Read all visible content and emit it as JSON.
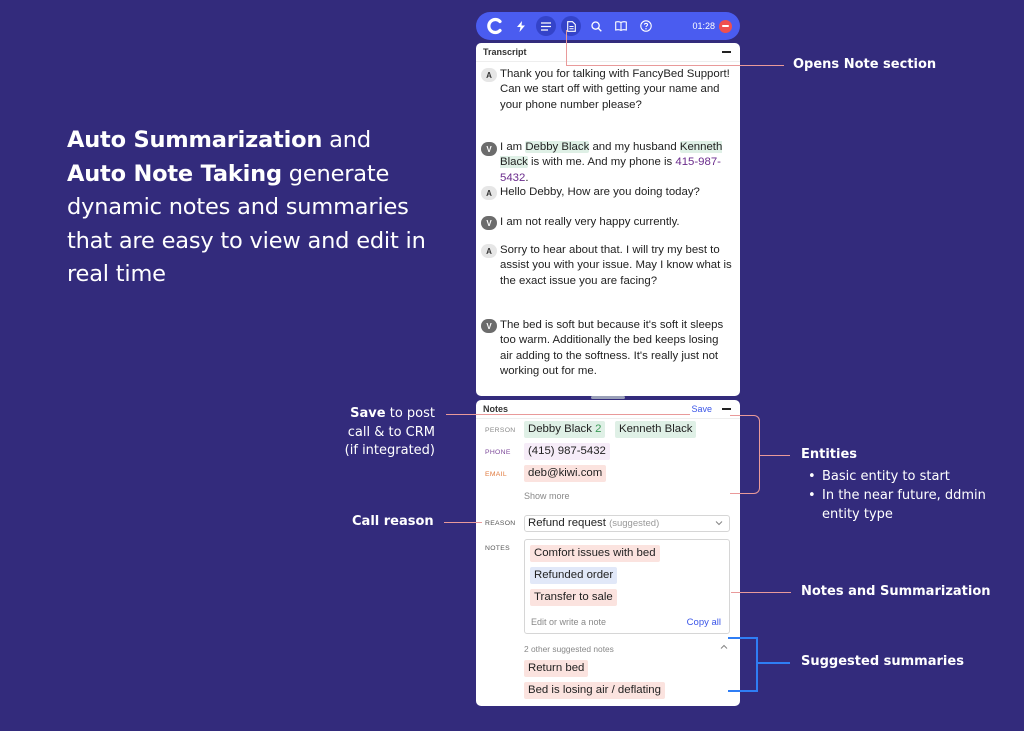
{
  "headline": {
    "bold1": "Auto Summarization",
    "and": " and ",
    "bold2": "Auto Note Taking",
    "rest": " generate dynamic notes and summaries that are easy to view and edit in real time"
  },
  "toolbar": {
    "icons": [
      "logo-icon",
      "bolt-icon",
      "transcript-lines-icon",
      "note-document-icon",
      "search-icon",
      "book-icon",
      "help-icon"
    ],
    "timer": "01:28",
    "accent": "#4a5cf0",
    "end_call_color": "#ef4f4f"
  },
  "transcript": {
    "title": "Transcript",
    "messages": [
      {
        "speaker": "A",
        "text": "Thank you for talking with FancyBed Support! Can we start off with getting your name and your phone number please?"
      },
      {
        "speaker": "V",
        "pre": "I am ",
        "person1": "Debby Black",
        "mid": " and my husband ",
        "person2": "Kenneth Black",
        "mid2": " is with me. And my phone is ",
        "phone": "415-987-5432",
        "post": "."
      },
      {
        "speaker": "A",
        "text": "Hello Debby, How are you doing today?"
      },
      {
        "speaker": "V",
        "text": "I am not really very happy currently."
      },
      {
        "speaker": "A",
        "text": "Sorry to hear about that. I will try my best to assist you with your issue. May I know what is the exact issue you are facing?"
      },
      {
        "speaker": "V",
        "text": "The bed is soft but because it's soft it sleeps too warm. Additionally the bed keeps losing air adding to the softness. It's really just not working out for me."
      }
    ]
  },
  "notes": {
    "title": "Notes",
    "save_label": "Save",
    "person_label": "PERSON",
    "person_tags": [
      {
        "name": "Debby Black",
        "count": "2"
      },
      {
        "name": "Kenneth Black"
      }
    ],
    "phone_label": "PHONE",
    "phone_value": "(415) 987-5432",
    "email_label": "EMAIL",
    "email_value": "deb@kiwi.com",
    "show_more": "Show more",
    "reason_label": "REASON",
    "reason_value": "Refund request",
    "reason_suggested": "(suggested)",
    "notes_label": "NOTES",
    "note_items": [
      "Comfort issues with bed",
      "Refunded order",
      "Transfer to sale"
    ],
    "edit_placeholder": "Edit or write a note",
    "copy_all": "Copy all",
    "other_suggested": "2 other suggested notes",
    "suggested_items": [
      "Return bed",
      "Bed is losing air / deflating"
    ],
    "colors": {
      "person": "#dff0e6",
      "phone": "#6a2b8c",
      "email": "#e07a3e",
      "link": "#3a55e8"
    }
  },
  "annotations": {
    "opens_note": "Opens Note section",
    "save_bold": "Save",
    "save_rest1": " to post",
    "save_rest2": "call & to CRM",
    "save_rest3": "(if integrated)",
    "call_reason": "Call reason",
    "entities": "Entities",
    "entity_bullets": [
      "Basic entity to start",
      "In the near future, ddmin entity type"
    ],
    "notes_summ": "Notes and Summarization",
    "suggested_summ": "Suggested summaries"
  }
}
